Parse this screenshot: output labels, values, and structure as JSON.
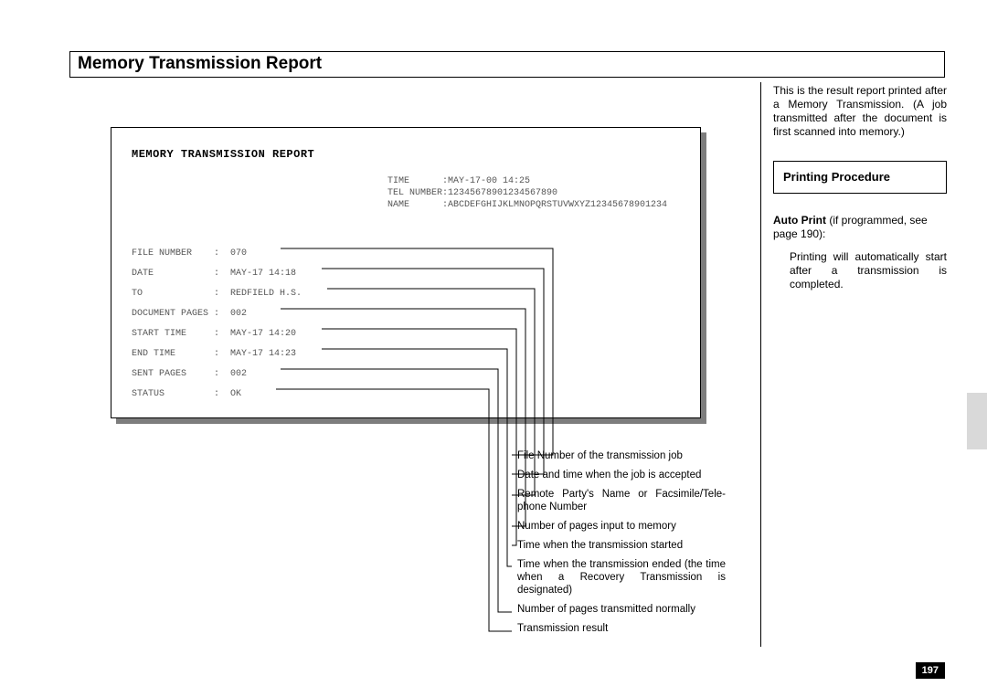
{
  "section_title": "Memory Transmission Report",
  "report": {
    "heading": "MEMORY TRANSMISSION REPORT",
    "header": {
      "time_label": "TIME      :",
      "time_value": "MAY-17-00 14:25",
      "tel_label": "TEL NUMBER:",
      "tel_value": "12345678901234567890",
      "name_label": "NAME      :",
      "name_value": "ABCDEFGHIJKLMNOPQRSTUVWXYZ12345678901234"
    },
    "fields": [
      {
        "label": "FILE NUMBER    ",
        "value": "070"
      },
      {
        "label": "DATE           ",
        "value": "MAY-17 14:18"
      },
      {
        "label": "TO             ",
        "value": "REDFIELD H.S."
      },
      {
        "label": "DOCUMENT PAGES ",
        "value": "002"
      },
      {
        "label": "START TIME     ",
        "value": "MAY-17 14:20"
      },
      {
        "label": "END TIME       ",
        "value": "MAY-17 14:23"
      },
      {
        "label": "SENT PAGES     ",
        "value": "002"
      },
      {
        "label": "STATUS         ",
        "value": "OK"
      }
    ]
  },
  "right": {
    "intro": "This is the result report printed after a Memory Transmission. (A job transmitted after the document is first scanned into memory.)",
    "procedure_title": "Printing Procedure",
    "autoprint_bold": "Auto Print",
    "autoprint_rest": " (if programmed, see page 190):",
    "autoprint_body": "Printing will automatically start after a transmission is completed."
  },
  "callouts": [
    "File Number of the transmission job",
    "Date and time when the job is accepted",
    "Remote Party's Name or Facsimile/Tele­phone Number",
    "Number of pages input to memory",
    "Time when the transmission started",
    "Time when the transmission ended (the time when a Recovery Transmission is designated)",
    "Number of pages transmitted normally",
    "Transmission result"
  ],
  "page_number": "197"
}
